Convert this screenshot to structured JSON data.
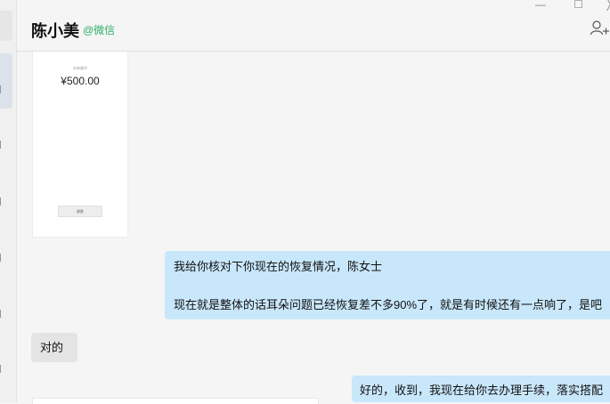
{
  "chat": {
    "contact_name": "陈小美",
    "contact_tag": "@微信"
  },
  "window": {
    "minimize_glyph": "—",
    "maximize_glyph": "☐",
    "close_glyph": "╳"
  },
  "messages": {
    "transfer_card": {
      "label": "向朱美华",
      "amount": "¥500.00",
      "button": "收款"
    },
    "agent_message": {
      "line1": "我给你核对下你现在的恢复情况，陈女士",
      "line2": "现在就是整体的话耳朵问题已经恢复差不多90%了，就是有时候还有一点响了，是吧"
    },
    "user_reply": "对的",
    "agent_followup": "好的，收到，我现在给你去办理手续，落实搭配"
  },
  "icons": [
    "add-contact-icon"
  ]
}
